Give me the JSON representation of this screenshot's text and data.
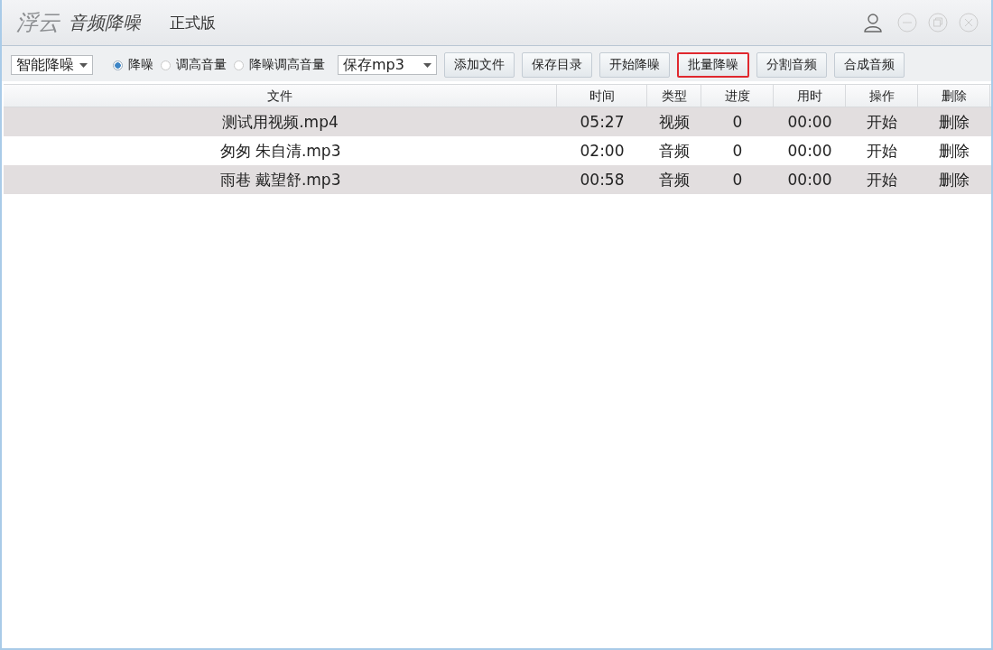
{
  "title_bar": {
    "logo": "浮云",
    "app_name": "音频降噪",
    "edition": "正式版"
  },
  "toolbar": {
    "mode_dropdown": {
      "value": "智能降噪"
    },
    "radios": [
      {
        "label": "降噪",
        "selected": true
      },
      {
        "label": "调高音量",
        "selected": false
      },
      {
        "label": "降噪调高音量",
        "selected": false
      }
    ],
    "format_dropdown": {
      "value": "保存mp3"
    },
    "buttons": [
      {
        "label": "添加文件",
        "highlighted": false
      },
      {
        "label": "保存目录",
        "highlighted": false
      },
      {
        "label": "开始降噪",
        "highlighted": false
      },
      {
        "label": "批量降噪",
        "highlighted": true
      },
      {
        "label": "分割音频",
        "highlighted": false
      },
      {
        "label": "合成音频",
        "highlighted": false
      }
    ]
  },
  "table": {
    "columns": [
      "文件",
      "时间",
      "类型",
      "进度",
      "用时",
      "操作",
      "删除"
    ],
    "rows": [
      {
        "file": "测试用视频.mp4",
        "time": "05:27",
        "type": "视频",
        "progress": "0",
        "elapsed": "00:00",
        "action": "开始",
        "delete": "删除"
      },
      {
        "file": "匆匆 朱自清.mp3",
        "time": "02:00",
        "type": "音频",
        "progress": "0",
        "elapsed": "00:00",
        "action": "开始",
        "delete": "删除"
      },
      {
        "file": "雨巷 戴望舒.mp3",
        "time": "00:58",
        "type": "音频",
        "progress": "0",
        "elapsed": "00:00",
        "action": "开始",
        "delete": "删除"
      }
    ]
  }
}
